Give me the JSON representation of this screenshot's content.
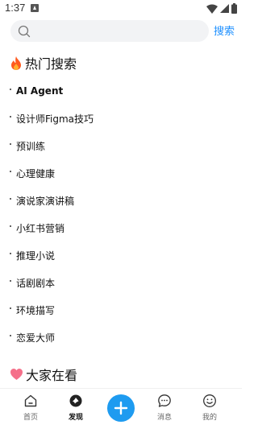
{
  "status_bar": {
    "time": "1:37"
  },
  "search": {
    "placeholder": "",
    "value": "",
    "button_label": "搜索"
  },
  "hot_search": {
    "title": "热门搜索",
    "items": [
      "AI Agent",
      "设计师Figma技巧",
      "预训练",
      "心理健康",
      "演说家演讲稿",
      "小红书营销",
      "推理小说",
      "话剧剧本",
      "环境描写",
      "恋爱大师"
    ]
  },
  "everyone_watching": {
    "title": "大家在看"
  },
  "bottom_nav": {
    "items": [
      {
        "label": "首页",
        "icon": "home-icon"
      },
      {
        "label": "发现",
        "icon": "discover-icon",
        "active": true
      },
      {
        "label": "",
        "icon": "plus-icon"
      },
      {
        "label": "消息",
        "icon": "message-icon"
      },
      {
        "label": "我的",
        "icon": "smile-icon"
      }
    ]
  },
  "colors": {
    "accent": "#1e9bf0",
    "search_link": "#1e90ff",
    "search_bg": "#f2f3f5",
    "fire": "#ff5a1f",
    "heart": "#f5708a"
  }
}
